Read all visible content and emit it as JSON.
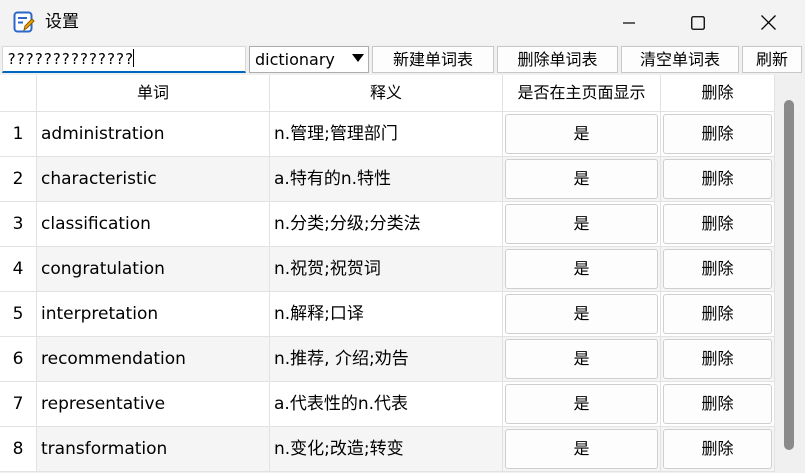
{
  "window": {
    "title": "设置",
    "icon": "notepad-app-icon",
    "controls": [
      "minimize-icon",
      "maximize-icon",
      "close-icon"
    ]
  },
  "toolbar": {
    "word_input_value": "??????????????",
    "dictionary_selected": "dictionary",
    "new_list_label": "新建单词表",
    "delete_list_label": "删除单词表",
    "clear_list_label": "清空单词表",
    "refresh_label": "刷新"
  },
  "table": {
    "headers": {
      "word": "单词",
      "meaning": "释义",
      "show_on_main": "是否在主页面显示",
      "delete": "删除"
    },
    "rows": [
      {
        "num": "1",
        "word": "administration",
        "meaning": "n.管理;管理部门",
        "show": "是",
        "delete": "删除"
      },
      {
        "num": "2",
        "word": "characteristic",
        "meaning": "a.特有的n.特性",
        "show": "是",
        "delete": "删除"
      },
      {
        "num": "3",
        "word": "classification",
        "meaning": "n.分类;分级;分类法",
        "show": "是",
        "delete": "删除"
      },
      {
        "num": "4",
        "word": "congratulation",
        "meaning": "n.祝贺;祝贺词",
        "show": "是",
        "delete": "删除"
      },
      {
        "num": "5",
        "word": "interpretation",
        "meaning": "n.解释;口译",
        "show": "是",
        "delete": "删除"
      },
      {
        "num": "6",
        "word": "recommendation",
        "meaning": "n.推荐, 介绍;劝告",
        "show": "是",
        "delete": "删除"
      },
      {
        "num": "7",
        "word": "representative",
        "meaning": "a.代表性的n.代表",
        "show": "是",
        "delete": "删除"
      },
      {
        "num": "8",
        "word": "transformation",
        "meaning": "n.变化;改造;转变",
        "show": "是",
        "delete": "删除"
      }
    ]
  },
  "colors": {
    "accent": "#0067c0",
    "alt_row": "#f5f5f5",
    "scroll_thumb": "#8a8a8a"
  }
}
